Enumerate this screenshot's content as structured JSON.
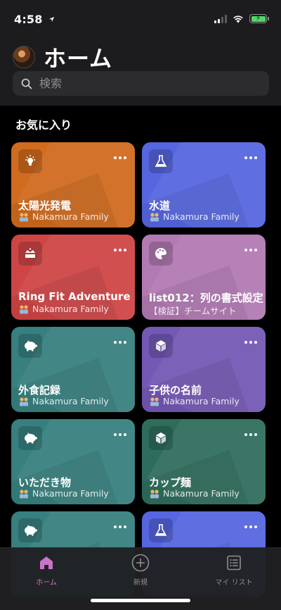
{
  "status": {
    "time": "4:58"
  },
  "header": {
    "title": "ホーム",
    "search_placeholder": "検索"
  },
  "section": {
    "favorites_title": "お気に入り"
  },
  "cards": [
    {
      "title": "太陽光発電",
      "subtitle": "Nakamura Family",
      "color": "#d16b1e",
      "icon": "lightbulb-icon"
    },
    {
      "title": "水道",
      "subtitle": "Nakamura Family",
      "color": "#5566e0",
      "icon": "flask-icon"
    },
    {
      "title": "Ring Fit Adventure",
      "subtitle": "Nakamura Family",
      "color": "#cf4545",
      "icon": "crown-icon"
    },
    {
      "title": "list012：列の書式設定",
      "subtitle": "【検証】チームサイト",
      "color": "#b27ab3",
      "icon": "palette-icon"
    },
    {
      "title": "外食記録",
      "subtitle": "Nakamura Family",
      "color": "#37807f",
      "icon": "piggy-bank-icon"
    },
    {
      "title": "子供の名前",
      "subtitle": "Nakamura Family",
      "color": "#7458b5",
      "icon": "cube-icon"
    },
    {
      "title": "いただき物",
      "subtitle": "Nakamura Family",
      "color": "#37807f",
      "icon": "piggy-bank-icon"
    },
    {
      "title": "カップ麺",
      "subtitle": "Nakamura Family",
      "color": "#2e6d5c",
      "icon": "cube-icon"
    },
    {
      "title": "",
      "subtitle": "",
      "color": "#37807f",
      "icon": "piggy-bank-icon"
    },
    {
      "title": "",
      "subtitle": "",
      "color": "#5566e0",
      "icon": "flask-icon"
    }
  ],
  "tabbar": {
    "home": "ホーム",
    "new": "新規",
    "my_lists": "マイ リスト"
  },
  "colors": {
    "active_tab": "#c973c9",
    "header_bg": "#1c1c1e"
  }
}
